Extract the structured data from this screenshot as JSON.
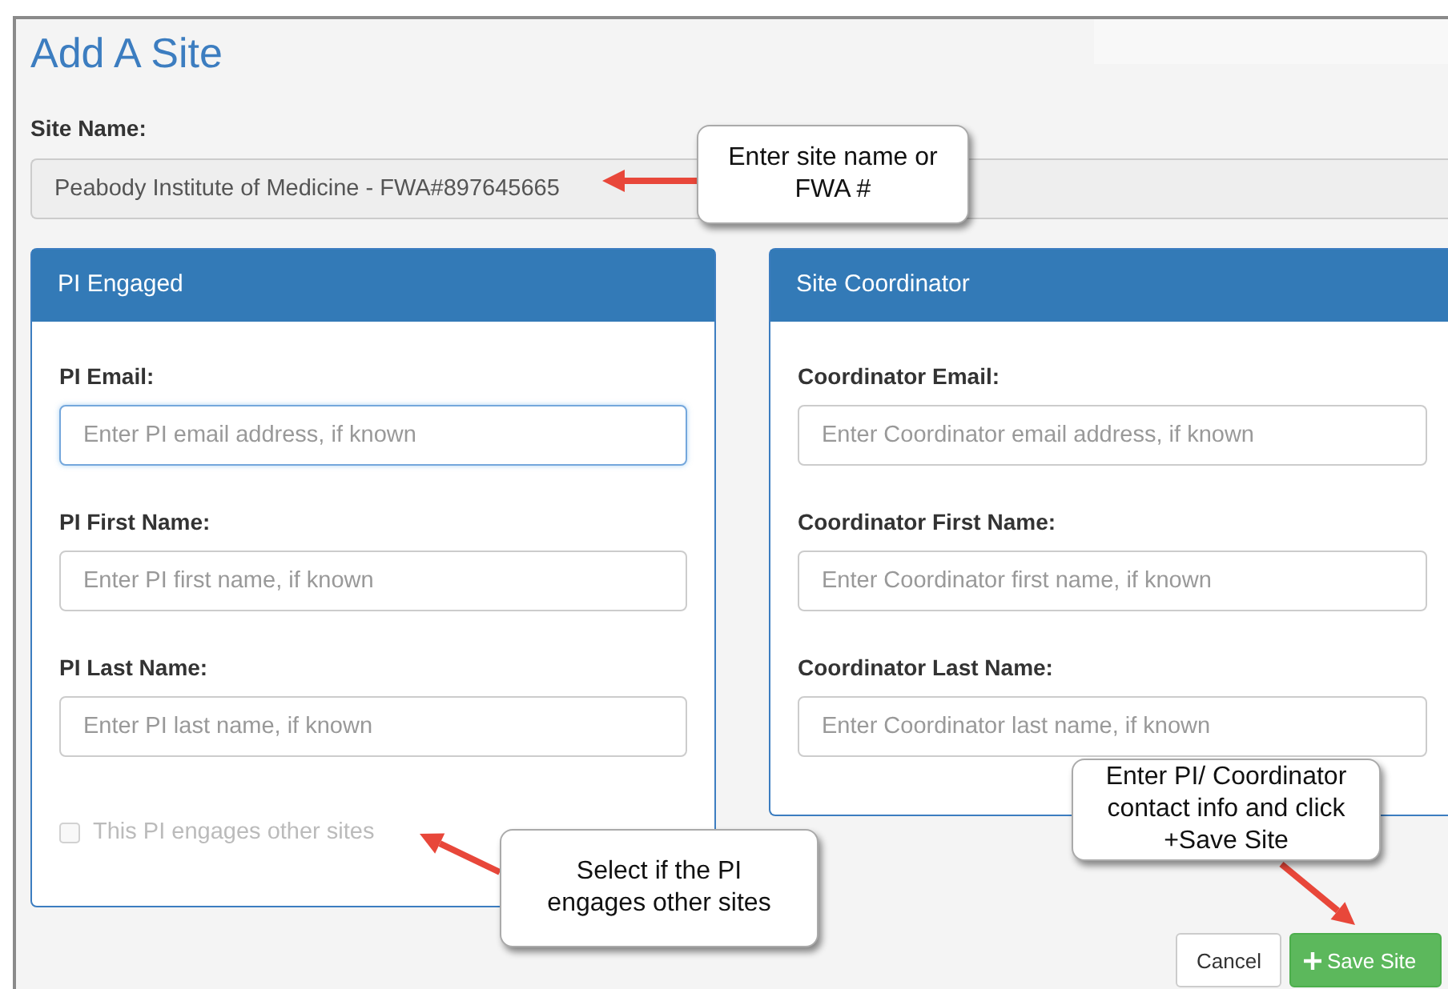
{
  "title": "Add A Site",
  "site_name": {
    "label": "Site Name:",
    "value": "Peabody Institute of Medicine - FWA#897645665"
  },
  "panels": [
    {
      "title": "PI Engaged",
      "fields": [
        {
          "label": "PI Email:",
          "placeholder": "Enter PI email address, if known",
          "focused": true
        },
        {
          "label": "PI First Name:",
          "placeholder": "Enter PI first name, if known",
          "focused": false
        },
        {
          "label": "PI Last Name:",
          "placeholder": "Enter PI last name, if known",
          "focused": false
        }
      ],
      "checkbox": {
        "label": "This PI engages other sites",
        "checked": false,
        "disabled": true
      }
    },
    {
      "title": "Site Coordinator",
      "fields": [
        {
          "label": "Coordinator Email:",
          "placeholder": "Enter Coordinator email address, if known",
          "focused": false
        },
        {
          "label": "Coordinator First Name:",
          "placeholder": "Enter Coordinator first name, if known",
          "focused": false
        },
        {
          "label": "Coordinator Last Name:",
          "placeholder": "Enter Coordinator last name, if known",
          "focused": false
        }
      ]
    }
  ],
  "buttons": [
    {
      "label": "Cancel",
      "kind": "default"
    },
    {
      "label": "Save Site",
      "kind": "primary"
    }
  ],
  "callouts": [
    {
      "text": "Enter site name or FWA #"
    },
    {
      "text": "Select if the PI engages other sites"
    },
    {
      "text": "Enter PI/ Coordinator contact info and click +Save Site"
    }
  ]
}
